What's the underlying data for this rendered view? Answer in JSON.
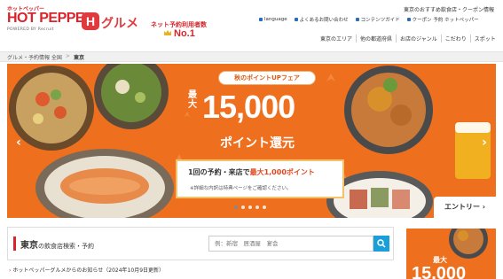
{
  "header": {
    "brand_small": "ホットペッパー",
    "brand_main": "HOT PEPPER",
    "powered_by": "POWERED BY Recruit",
    "brand_mark": "H",
    "brand_gourmet": "グルメ",
    "promo_label": "ネット予約利用者数",
    "promo_value": "No.1",
    "top_note": "東京のおすすめ飲食店・クーポン情報",
    "util_links": [
      "language",
      "よくあるお問い合わせ",
      "コンテンツガイド",
      "クーポン 予約 ホットペッパー"
    ],
    "gnav": [
      "東京のエリア",
      "他の都道府県",
      "お店のジャンル",
      "こだわり",
      "スポット"
    ]
  },
  "breadcrumb": [
    "グルメ・予約情報 全国",
    "東京"
  ],
  "hero": {
    "campaign": "秋のポイントUPフェア",
    "max_label": "最大",
    "amount": "15,000",
    "return_text": "ポイント還元",
    "info_main_prefix": "1回の予約・来店で",
    "info_main_highlight": "最大1,000ポイント",
    "info_note": "※詳細な内訳は特典ページをご確認ください。",
    "entry": "エントリー",
    "slide_count": 5,
    "active_slide": 1
  },
  "search": {
    "title": "東京",
    "subtitle": "の飲食店検索・予約",
    "placeholder": "例：新宿　居酒屋　宴会"
  },
  "news": "ホットペッパーグルメからのお知らせ（2024年10月9日更新）",
  "side_ad": {
    "max_label": "最大",
    "amount": "15,000"
  },
  "colors": {
    "brand_red": "#d8242c",
    "hero_orange": "#ee6f1e",
    "search_blue": "#1a9fd8"
  }
}
